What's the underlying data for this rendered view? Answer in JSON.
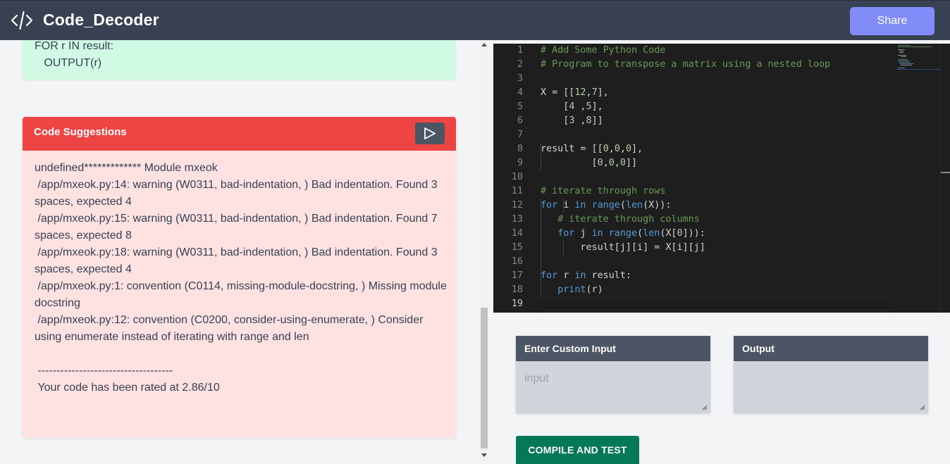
{
  "header": {
    "title": "Code_Decoder",
    "share_label": "Share"
  },
  "pseudocode": {
    "lines": [
      "FOR r IN result:",
      "   OUTPUT(r)"
    ]
  },
  "suggestions": {
    "title": "Code Suggestions",
    "body": "undefined************* Module mxeok\n /app/mxeok.py:14: warning (W0311, bad-indentation, ) Bad indentation. Found 3 spaces, expected 4\n /app/mxeok.py:15: warning (W0311, bad-indentation, ) Bad indentation. Found 7 spaces, expected 8\n /app/mxeok.py:18: warning (W0311, bad-indentation, ) Bad indentation. Found 3 spaces, expected 4\n /app/mxeok.py:1: convention (C0114, missing-module-docstring, ) Missing module docstring\n /app/mxeok.py:12: convention (C0200, consider-using-enumerate, ) Consider using enumerate instead of iterating with range and len\n\n ------------------------------------\n Your code has been rated at 2.86/10"
  },
  "editor": {
    "line_numbers": [
      "1",
      "2",
      "3",
      "4",
      "5",
      "6",
      "7",
      "8",
      "9",
      "10",
      "11",
      "12",
      "13",
      "14",
      "15",
      "16",
      "17",
      "18",
      "19"
    ],
    "active_line": 19
  },
  "input_box": {
    "title": "Enter Custom Input",
    "placeholder": "input"
  },
  "output_box": {
    "title": "Output"
  },
  "compile_label": "COMPILE AND TEST",
  "colors": {
    "header": "#374151",
    "share": "#818cf8",
    "suggestions_header": "#ef4444",
    "suggestions_body": "#fee2e2",
    "pseudocode_bg": "#d1fae5",
    "compile": "#047857",
    "editor_bg": "#1e1e1e"
  },
  "icons": {
    "logo": "code-brackets-icon",
    "run": "play-icon"
  }
}
